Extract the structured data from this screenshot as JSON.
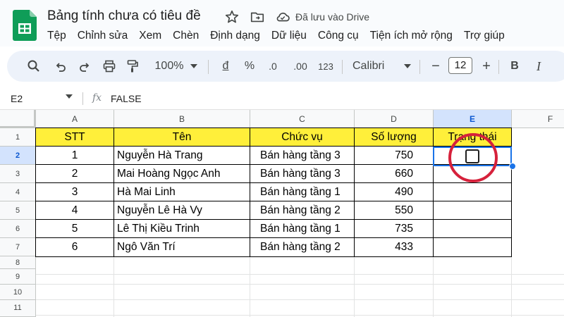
{
  "header": {
    "doc_title": "Bảng tính chưa có tiêu đề",
    "save_status": "Đã lưu vào Drive",
    "menu": [
      "Tệp",
      "Chỉnh sửa",
      "Xem",
      "Chèn",
      "Định dạng",
      "Dữ liệu",
      "Công cụ",
      "Tiện ích mở rộng",
      "Trợ giúp"
    ]
  },
  "toolbar": {
    "zoom": "100%",
    "currency_symbol": "đ",
    "percent_symbol": "%",
    "decrease_decimal": ".0",
    "increase_decimal": ".00",
    "number_format": "123",
    "font": "Calibri",
    "font_size": "12",
    "minus": "−",
    "plus": "+",
    "bold": "B",
    "italic": "I"
  },
  "formula_bar": {
    "cell_ref": "E2",
    "fx": "fx",
    "value": "FALSE"
  },
  "sheet": {
    "columns": [
      "A",
      "B",
      "C",
      "D",
      "E",
      "F"
    ],
    "selected_column": "E",
    "rows": [
      "1",
      "2",
      "3",
      "4",
      "5",
      "6",
      "7",
      "8",
      "9",
      "10",
      "11"
    ],
    "selected_row": "2",
    "table_headers": [
      "STT",
      "Tên",
      "Chức vụ",
      "Số lượng",
      "Trạng thái"
    ],
    "table_rows": [
      {
        "stt": "1",
        "name": "Nguyễn Hà Trang",
        "role": "Bán hàng tầng 3",
        "qty": "750"
      },
      {
        "stt": "2",
        "name": "Mai Hoàng Ngọc Anh",
        "role": "Bán hàng tầng 3",
        "qty": "660"
      },
      {
        "stt": "3",
        "name": "Hà Mai Linh",
        "role": "Bán hàng tầng 1",
        "qty": "490"
      },
      {
        "stt": "4",
        "name": "Nguyễn Lê Hà Vy",
        "role": "Bán hàng tầng 2",
        "qty": "550"
      },
      {
        "stt": "5",
        "name": "Lê Thị Kiều Trinh",
        "role": "Bán hàng tầng 1",
        "qty": "735"
      },
      {
        "stt": "6",
        "name": "Ngô Văn Trí",
        "role": "Bán hàng tầng 2",
        "qty": "433"
      }
    ]
  },
  "colors": {
    "header_fill": "#ffef3a",
    "selection": "#1a73e8",
    "annotation": "#d6213b",
    "logo_green": "#0f9d58"
  },
  "icons": [
    "sheets-logo",
    "star-icon",
    "move-to-folder-icon",
    "cloud-saved-icon",
    "search-icon",
    "undo-icon",
    "redo-icon",
    "print-icon",
    "paint-format-icon",
    "chevron-down-icon",
    "checkbox-icon"
  ]
}
